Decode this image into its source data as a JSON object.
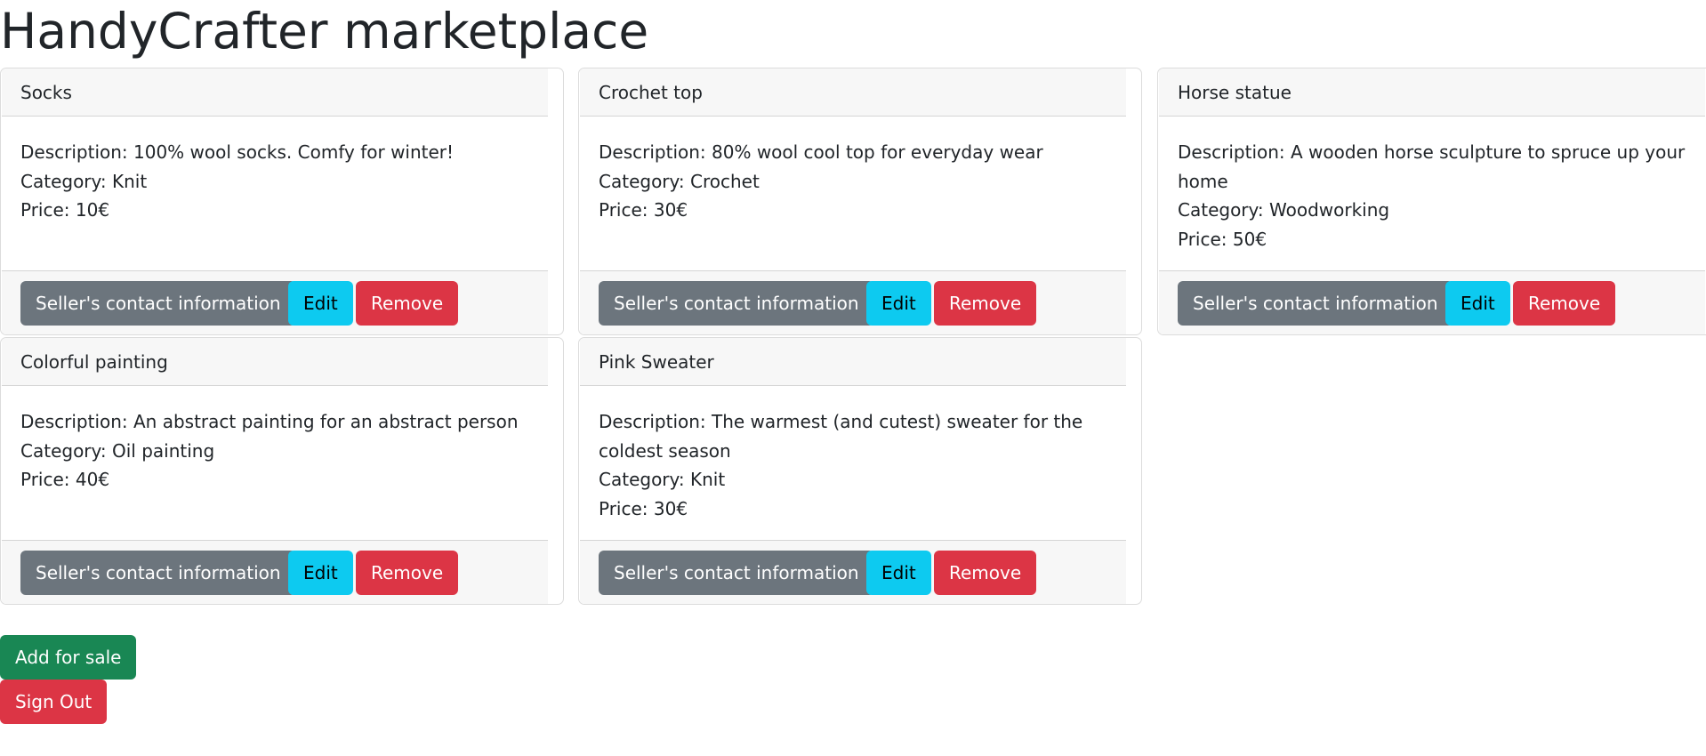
{
  "page": {
    "title": "HandyCrafter marketplace"
  },
  "products": [
    {
      "name": "Socks",
      "description": "Description: 100% wool socks. Comfy for winter!",
      "category": "Category: Knit",
      "price": "Price: 10€",
      "contact_label": "Seller's contact information",
      "edit_label": "Edit",
      "remove_label": "Remove"
    },
    {
      "name": "Crochet top",
      "description": "Description: 80% wool cool top for everyday wear",
      "category": "Category: Crochet",
      "price": "Price: 30€",
      "contact_label": "Seller's contact information",
      "edit_label": "Edit",
      "remove_label": "Remove"
    },
    {
      "name": "Horse statue",
      "description": "Description: A wooden horse sculpture to spruce up your home",
      "category": "Category: Woodworking",
      "price": "Price: 50€",
      "contact_label": "Seller's contact information",
      "edit_label": "Edit",
      "remove_label": "Remove"
    },
    {
      "name": "Colorful painting",
      "description": "Description: An abstract painting for an abstract person",
      "category": "Category: Oil painting",
      "price": "Price: 40€",
      "contact_label": "Seller's contact information",
      "edit_label": "Edit",
      "remove_label": "Remove"
    },
    {
      "name": "Pink Sweater",
      "description": "Description: The warmest (and cutest) sweater for the coldest season",
      "category": "Category: Knit",
      "price": "Price: 30€",
      "contact_label": "Seller's contact information",
      "edit_label": "Edit",
      "remove_label": "Remove"
    }
  ],
  "actions": {
    "add_label": "Add for sale",
    "signout_label": "Sign Out"
  },
  "colors": {
    "secondary": "#6c757d",
    "info": "#0dcaf0",
    "danger": "#dc3545",
    "success": "#198754"
  }
}
